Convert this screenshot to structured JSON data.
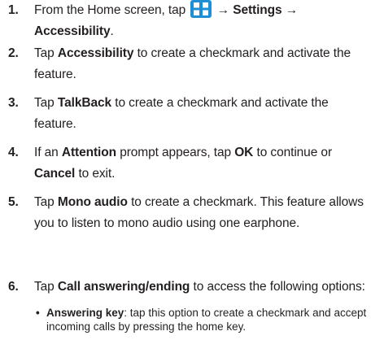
{
  "steps": [
    {
      "number": "1.",
      "line1_pre": "From the Home screen, tap",
      "line1_post": "→ Settings →",
      "line2": "Accessibility",
      "line2_end": "."
    },
    {
      "number": "2.",
      "t1": "Tap ",
      "b1": "Accessibility",
      "t2": " to create a checkmark and activate the",
      "line2": "feature."
    },
    {
      "number": "3.",
      "t1": "Tap ",
      "b1": "TalkBack",
      "t2": " to create a checkmark and activate the",
      "line2": "feature."
    },
    {
      "number": "4.",
      "t1": "If an ",
      "b1": "Attention",
      "t2": " prompt appears, tap ",
      "b2": "OK",
      "t3": " to continue or",
      "b3": "Cancel",
      "t4": " to exit."
    },
    {
      "number": "5.",
      "t1": "Tap ",
      "b1": "Mono audio",
      "t2": " to create a checkmark. This feature allows",
      "line2": "you to listen to mono audio using one earphone."
    },
    {
      "number": "6.",
      "t1": "Tap ",
      "b1": "Call answering/ending",
      "t2": " to access the following options:"
    }
  ],
  "bullet": {
    "symbol": "•",
    "label": "Answering key",
    "text1": ": tap this option to create a checkmark and accept",
    "text2": "incoming calls by pressing the home key."
  },
  "icons": {
    "apps": "apps-grid-icon"
  },
  "colors": {
    "text": "#231f20",
    "apps_icon_bg": "#1e8fd6"
  }
}
